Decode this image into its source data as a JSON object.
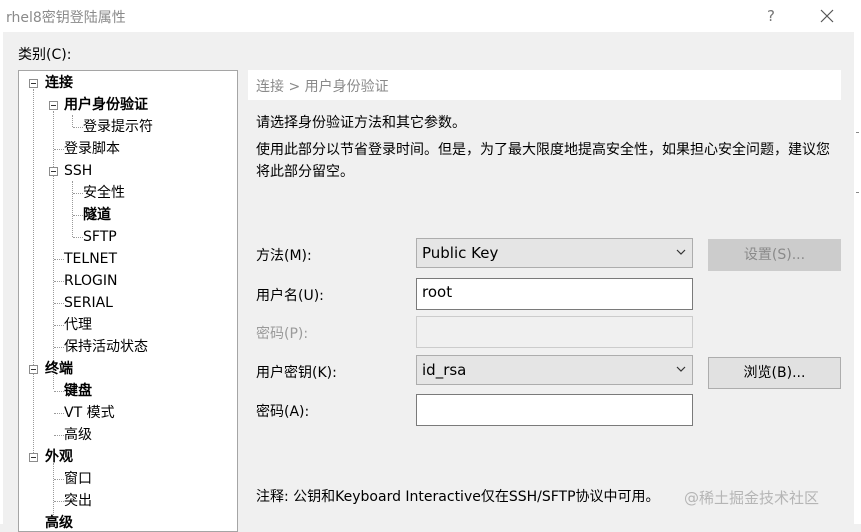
{
  "window": {
    "title": "rhel8密钥登陆属性",
    "help_label": "?"
  },
  "category_label": "类别(C):",
  "tree": [
    {
      "label": "连接",
      "bold": true
    },
    {
      "label": "用户身份验证",
      "bold": true
    },
    {
      "label": "登录提示符",
      "bold": false
    },
    {
      "label": "登录脚本",
      "bold": false
    },
    {
      "label": "SSH",
      "bold": false
    },
    {
      "label": "安全性",
      "bold": false
    },
    {
      "label": "隧道",
      "bold": true
    },
    {
      "label": "SFTP",
      "bold": false
    },
    {
      "label": "TELNET",
      "bold": false
    },
    {
      "label": "RLOGIN",
      "bold": false
    },
    {
      "label": "SERIAL",
      "bold": false
    },
    {
      "label": "代理",
      "bold": false
    },
    {
      "label": "保持活动状态",
      "bold": false
    },
    {
      "label": "终端",
      "bold": true
    },
    {
      "label": "键盘",
      "bold": true
    },
    {
      "label": "VT 模式",
      "bold": false
    },
    {
      "label": "高级",
      "bold": false
    },
    {
      "label": "外观",
      "bold": true
    },
    {
      "label": "窗口",
      "bold": false
    },
    {
      "label": "突出",
      "bold": false
    },
    {
      "label": "高级",
      "bold": true
    }
  ],
  "selected_item": "用户身份验证",
  "breadcrumb": "连接 > 用户身份验证",
  "intro": "请选择身份验证方法和其它参数。",
  "description": "使用此部分以节省登录时间。但是，为了最大限度地提高安全性，如果担心安全问题，建议您将此部分留空。",
  "form": {
    "method_label": "方法(M):",
    "method_value": "Public Key",
    "settings_button": "设置(S)...",
    "username_label": "用户名(U):",
    "username_value": "root",
    "password_label": "密码(P):",
    "password_value": "",
    "user_key_label": "用户密钥(K):",
    "user_key_value": "id_rsa",
    "browse_button": "浏览(B)...",
    "passphrase_label": "密码(A):",
    "passphrase_value": ""
  },
  "note": "注释: 公钥和Keyboard Interactive仅在SSH/SFTP协议中可用。",
  "watermark": "@稀土掘金技术社区"
}
